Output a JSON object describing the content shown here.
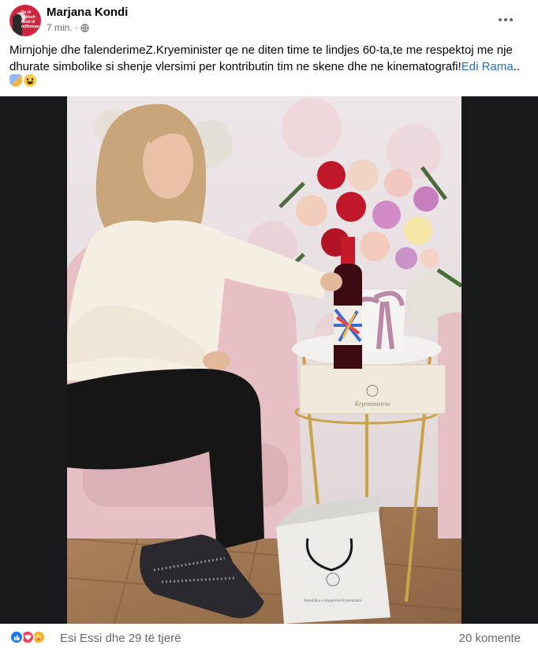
{
  "post": {
    "author": "Marjana Kondi",
    "time": "7 min.",
    "separator": "·",
    "caption_text": "Mirnjohje dhe falenderimeZ.Kryeminister qe ne diten time te lindjes 60-ta,te me respektoj me nje dhurate simbolike si shenje vlersimi per kontributin tim ne skene dhe ne kinematografi!",
    "caption_tag": "Edi Rama",
    "caption_suffix": "..",
    "emojis": [
      "masks-emoji",
      "smiley-emoji"
    ],
    "avatar_text": "Ne të kujtosh kush të ndihmuar"
  },
  "photo": {
    "description_icons": [
      "woman-seated",
      "flower-bouquet",
      "wine-bottle",
      "wine-box",
      "gift-bag",
      "side-table",
      "pink-chair"
    ],
    "box_label": "Kryeministria",
    "bag_label": "Republika e Shqipërisë Kryeministri"
  },
  "footer": {
    "reactions": [
      "like-icon",
      "love-icon",
      "care-icon"
    ],
    "reactors_text": "Esi Essi dhe 29 të tjerë",
    "comments_text": "20 komente"
  },
  "colors": {
    "link": "#216fdb",
    "secondary_text": "#65676b",
    "photo_bg": "#18191a",
    "like": "#1877f2",
    "love": "#f33e58",
    "care": "#f7b125"
  }
}
